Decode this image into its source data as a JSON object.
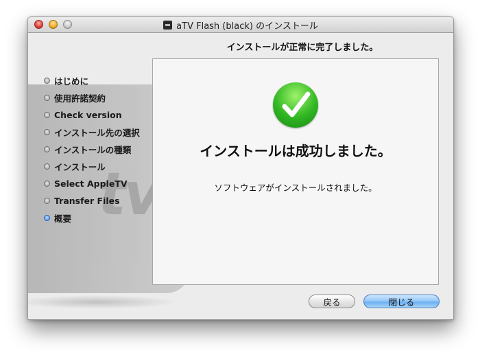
{
  "window": {
    "title": "aTV Flash (black) のインストール"
  },
  "heading": "インストールが正常に完了しました。",
  "steps": [
    {
      "label": "はじめに"
    },
    {
      "label": "使用許諾契約"
    },
    {
      "label": "Check version"
    },
    {
      "label": "インストール先の選択"
    },
    {
      "label": "インストールの種類"
    },
    {
      "label": "インストール"
    },
    {
      "label": "Select AppleTV"
    },
    {
      "label": "Transfer Files"
    },
    {
      "label": "概要"
    }
  ],
  "active_step": "概要",
  "content": {
    "title": "インストールは成功しました。",
    "message": "ソフトウェアがインストールされました。"
  },
  "buttons": {
    "back_label": "戻る",
    "close_label": "閉じる"
  },
  "icons": {
    "success": "checkmark-icon",
    "app": "app-icon"
  },
  "colors": {
    "success_green": "#30b622",
    "default_button_blue": "#6aaef1",
    "active_bullet": "#3b7ee6"
  }
}
